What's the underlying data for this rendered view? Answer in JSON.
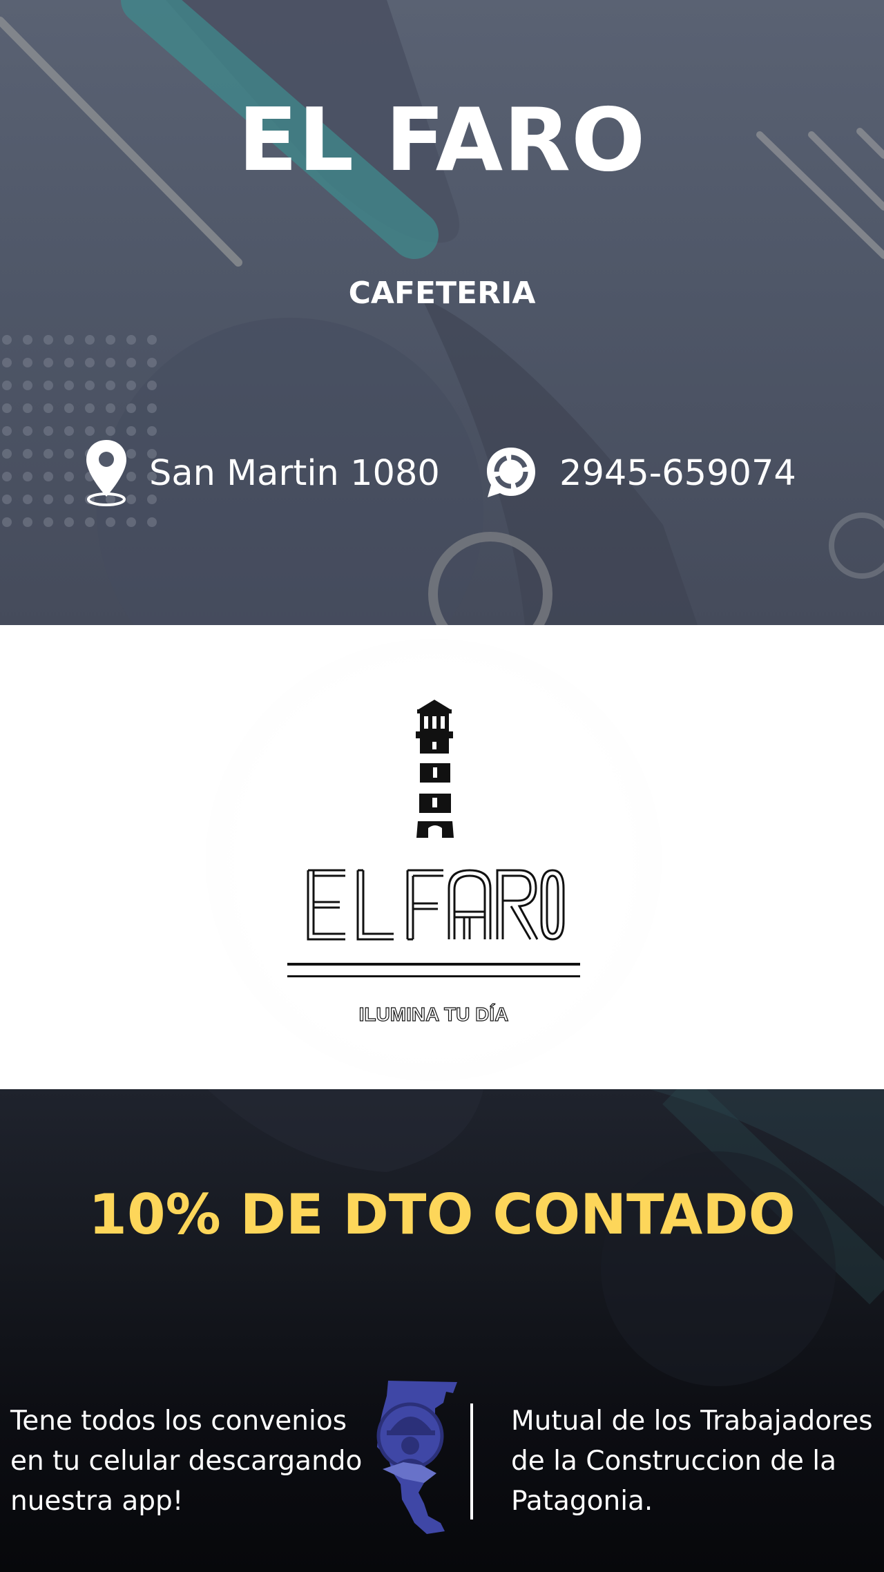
{
  "header": {
    "title": "EL FARO",
    "subtitle": "CAFETERIA",
    "address": {
      "icon": "map-pin-icon",
      "text": "San Martin 1080"
    },
    "phone": {
      "icon": "whatsapp-icon",
      "text": "2945-659074"
    }
  },
  "logo": {
    "icon": "lighthouse-icon",
    "wordmark": "EL FARO",
    "tagline": "ILUMINA TU DÍA"
  },
  "promo": {
    "text": "10% DE DTO CONTADO",
    "color": "#fdd65a"
  },
  "footer": {
    "app_text": "Tene todos los convenios en tu celular descargando nuestra app!",
    "mutual_logo_icon": "mutual-emblem-icon",
    "mutual_text": "Mutual de los Trabajadores de la Construccion de la Patagonia."
  }
}
